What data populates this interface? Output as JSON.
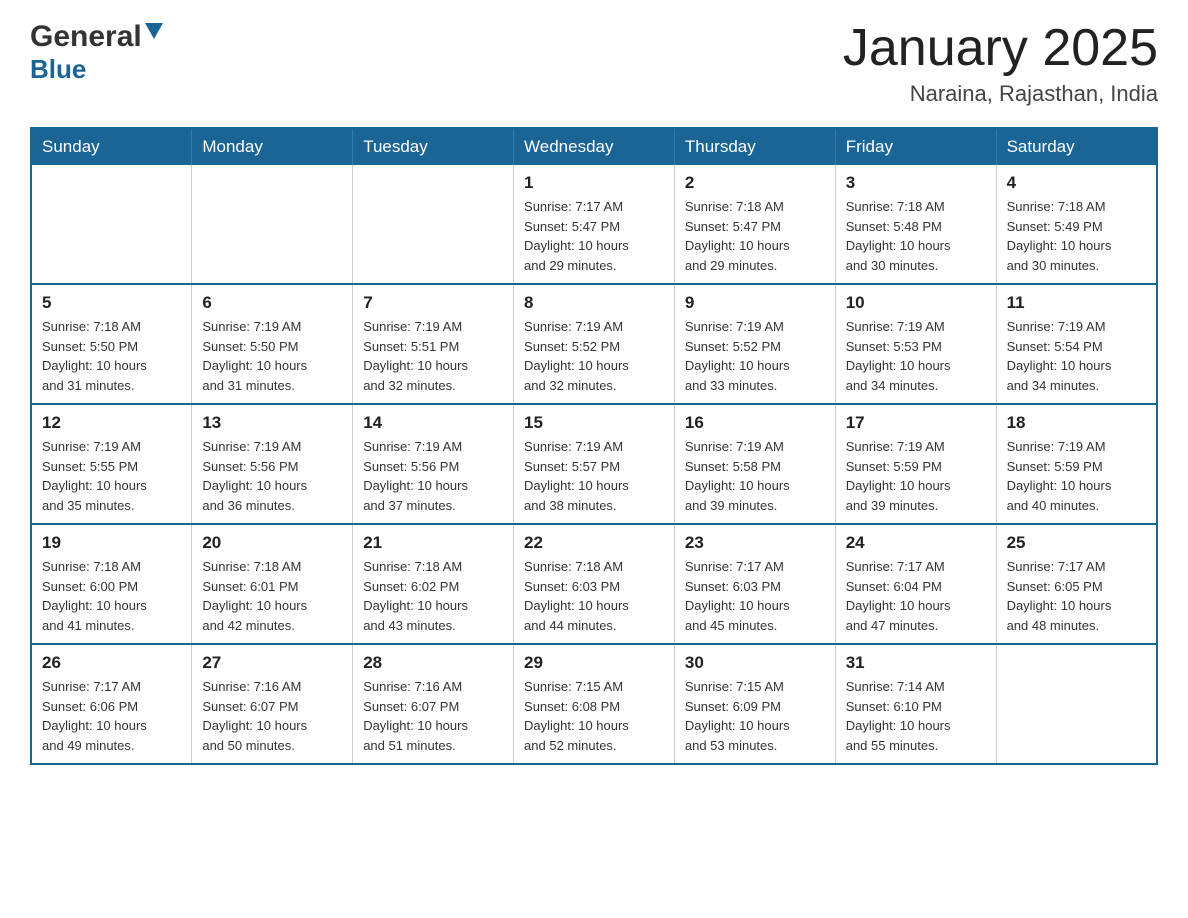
{
  "header": {
    "logo_general": "General",
    "logo_blue": "Blue",
    "month_title": "January 2025",
    "location": "Naraina, Rajasthan, India"
  },
  "days_of_week": [
    "Sunday",
    "Monday",
    "Tuesday",
    "Wednesday",
    "Thursday",
    "Friday",
    "Saturday"
  ],
  "weeks": [
    [
      {
        "day": "",
        "info": ""
      },
      {
        "day": "",
        "info": ""
      },
      {
        "day": "",
        "info": ""
      },
      {
        "day": "1",
        "info": "Sunrise: 7:17 AM\nSunset: 5:47 PM\nDaylight: 10 hours\nand 29 minutes."
      },
      {
        "day": "2",
        "info": "Sunrise: 7:18 AM\nSunset: 5:47 PM\nDaylight: 10 hours\nand 29 minutes."
      },
      {
        "day": "3",
        "info": "Sunrise: 7:18 AM\nSunset: 5:48 PM\nDaylight: 10 hours\nand 30 minutes."
      },
      {
        "day": "4",
        "info": "Sunrise: 7:18 AM\nSunset: 5:49 PM\nDaylight: 10 hours\nand 30 minutes."
      }
    ],
    [
      {
        "day": "5",
        "info": "Sunrise: 7:18 AM\nSunset: 5:50 PM\nDaylight: 10 hours\nand 31 minutes."
      },
      {
        "day": "6",
        "info": "Sunrise: 7:19 AM\nSunset: 5:50 PM\nDaylight: 10 hours\nand 31 minutes."
      },
      {
        "day": "7",
        "info": "Sunrise: 7:19 AM\nSunset: 5:51 PM\nDaylight: 10 hours\nand 32 minutes."
      },
      {
        "day": "8",
        "info": "Sunrise: 7:19 AM\nSunset: 5:52 PM\nDaylight: 10 hours\nand 32 minutes."
      },
      {
        "day": "9",
        "info": "Sunrise: 7:19 AM\nSunset: 5:52 PM\nDaylight: 10 hours\nand 33 minutes."
      },
      {
        "day": "10",
        "info": "Sunrise: 7:19 AM\nSunset: 5:53 PM\nDaylight: 10 hours\nand 34 minutes."
      },
      {
        "day": "11",
        "info": "Sunrise: 7:19 AM\nSunset: 5:54 PM\nDaylight: 10 hours\nand 34 minutes."
      }
    ],
    [
      {
        "day": "12",
        "info": "Sunrise: 7:19 AM\nSunset: 5:55 PM\nDaylight: 10 hours\nand 35 minutes."
      },
      {
        "day": "13",
        "info": "Sunrise: 7:19 AM\nSunset: 5:56 PM\nDaylight: 10 hours\nand 36 minutes."
      },
      {
        "day": "14",
        "info": "Sunrise: 7:19 AM\nSunset: 5:56 PM\nDaylight: 10 hours\nand 37 minutes."
      },
      {
        "day": "15",
        "info": "Sunrise: 7:19 AM\nSunset: 5:57 PM\nDaylight: 10 hours\nand 38 minutes."
      },
      {
        "day": "16",
        "info": "Sunrise: 7:19 AM\nSunset: 5:58 PM\nDaylight: 10 hours\nand 39 minutes."
      },
      {
        "day": "17",
        "info": "Sunrise: 7:19 AM\nSunset: 5:59 PM\nDaylight: 10 hours\nand 39 minutes."
      },
      {
        "day": "18",
        "info": "Sunrise: 7:19 AM\nSunset: 5:59 PM\nDaylight: 10 hours\nand 40 minutes."
      }
    ],
    [
      {
        "day": "19",
        "info": "Sunrise: 7:18 AM\nSunset: 6:00 PM\nDaylight: 10 hours\nand 41 minutes."
      },
      {
        "day": "20",
        "info": "Sunrise: 7:18 AM\nSunset: 6:01 PM\nDaylight: 10 hours\nand 42 minutes."
      },
      {
        "day": "21",
        "info": "Sunrise: 7:18 AM\nSunset: 6:02 PM\nDaylight: 10 hours\nand 43 minutes."
      },
      {
        "day": "22",
        "info": "Sunrise: 7:18 AM\nSunset: 6:03 PM\nDaylight: 10 hours\nand 44 minutes."
      },
      {
        "day": "23",
        "info": "Sunrise: 7:17 AM\nSunset: 6:03 PM\nDaylight: 10 hours\nand 45 minutes."
      },
      {
        "day": "24",
        "info": "Sunrise: 7:17 AM\nSunset: 6:04 PM\nDaylight: 10 hours\nand 47 minutes."
      },
      {
        "day": "25",
        "info": "Sunrise: 7:17 AM\nSunset: 6:05 PM\nDaylight: 10 hours\nand 48 minutes."
      }
    ],
    [
      {
        "day": "26",
        "info": "Sunrise: 7:17 AM\nSunset: 6:06 PM\nDaylight: 10 hours\nand 49 minutes."
      },
      {
        "day": "27",
        "info": "Sunrise: 7:16 AM\nSunset: 6:07 PM\nDaylight: 10 hours\nand 50 minutes."
      },
      {
        "day": "28",
        "info": "Sunrise: 7:16 AM\nSunset: 6:07 PM\nDaylight: 10 hours\nand 51 minutes."
      },
      {
        "day": "29",
        "info": "Sunrise: 7:15 AM\nSunset: 6:08 PM\nDaylight: 10 hours\nand 52 minutes."
      },
      {
        "day": "30",
        "info": "Sunrise: 7:15 AM\nSunset: 6:09 PM\nDaylight: 10 hours\nand 53 minutes."
      },
      {
        "day": "31",
        "info": "Sunrise: 7:14 AM\nSunset: 6:10 PM\nDaylight: 10 hours\nand 55 minutes."
      },
      {
        "day": "",
        "info": ""
      }
    ]
  ]
}
